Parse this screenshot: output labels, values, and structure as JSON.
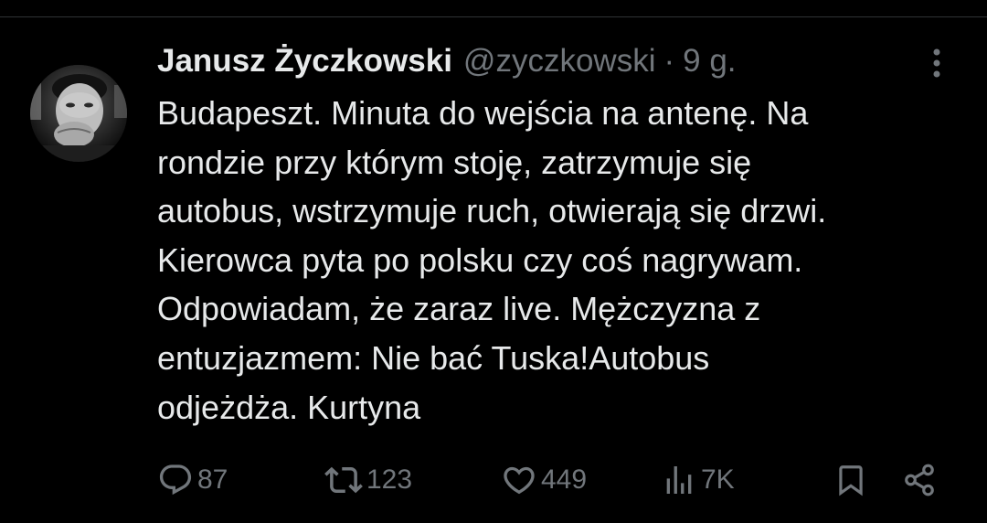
{
  "tweet": {
    "author": {
      "display_name": "Janusz Życzkowski",
      "handle": "@zyczkowski",
      "avatar_icon": "profile-photo"
    },
    "separator": "·",
    "timestamp": "9 g.",
    "lines": [
      "Budapeszt. Minuta do wejścia na antenę. Na",
      "rondzie przy którym stoję, zatrzymuje się",
      "autobus, wstrzymuje ruch, otwierają się drzwi.",
      "Kierowca pyta po polsku czy coś nagrywam.",
      "Odpowiadam, że zaraz live. Mężczyzna z",
      "entuzjazmem: Nie bać Tuska!Autobus",
      "odjeżdża. Kurtyna"
    ],
    "actions": {
      "replies": "87",
      "reposts": "123",
      "likes": "449",
      "views": "7K"
    }
  },
  "colors": {
    "background": "#000000",
    "primary_text": "#e7e9ea",
    "secondary_text": "#71767b",
    "divider": "#2f3336"
  },
  "icons": {
    "more": "more-vertical-icon",
    "reply": "reply-icon",
    "repost": "repost-icon",
    "like": "heart-icon",
    "views": "views-icon",
    "bookmark": "bookmark-icon",
    "share": "share-icon"
  }
}
